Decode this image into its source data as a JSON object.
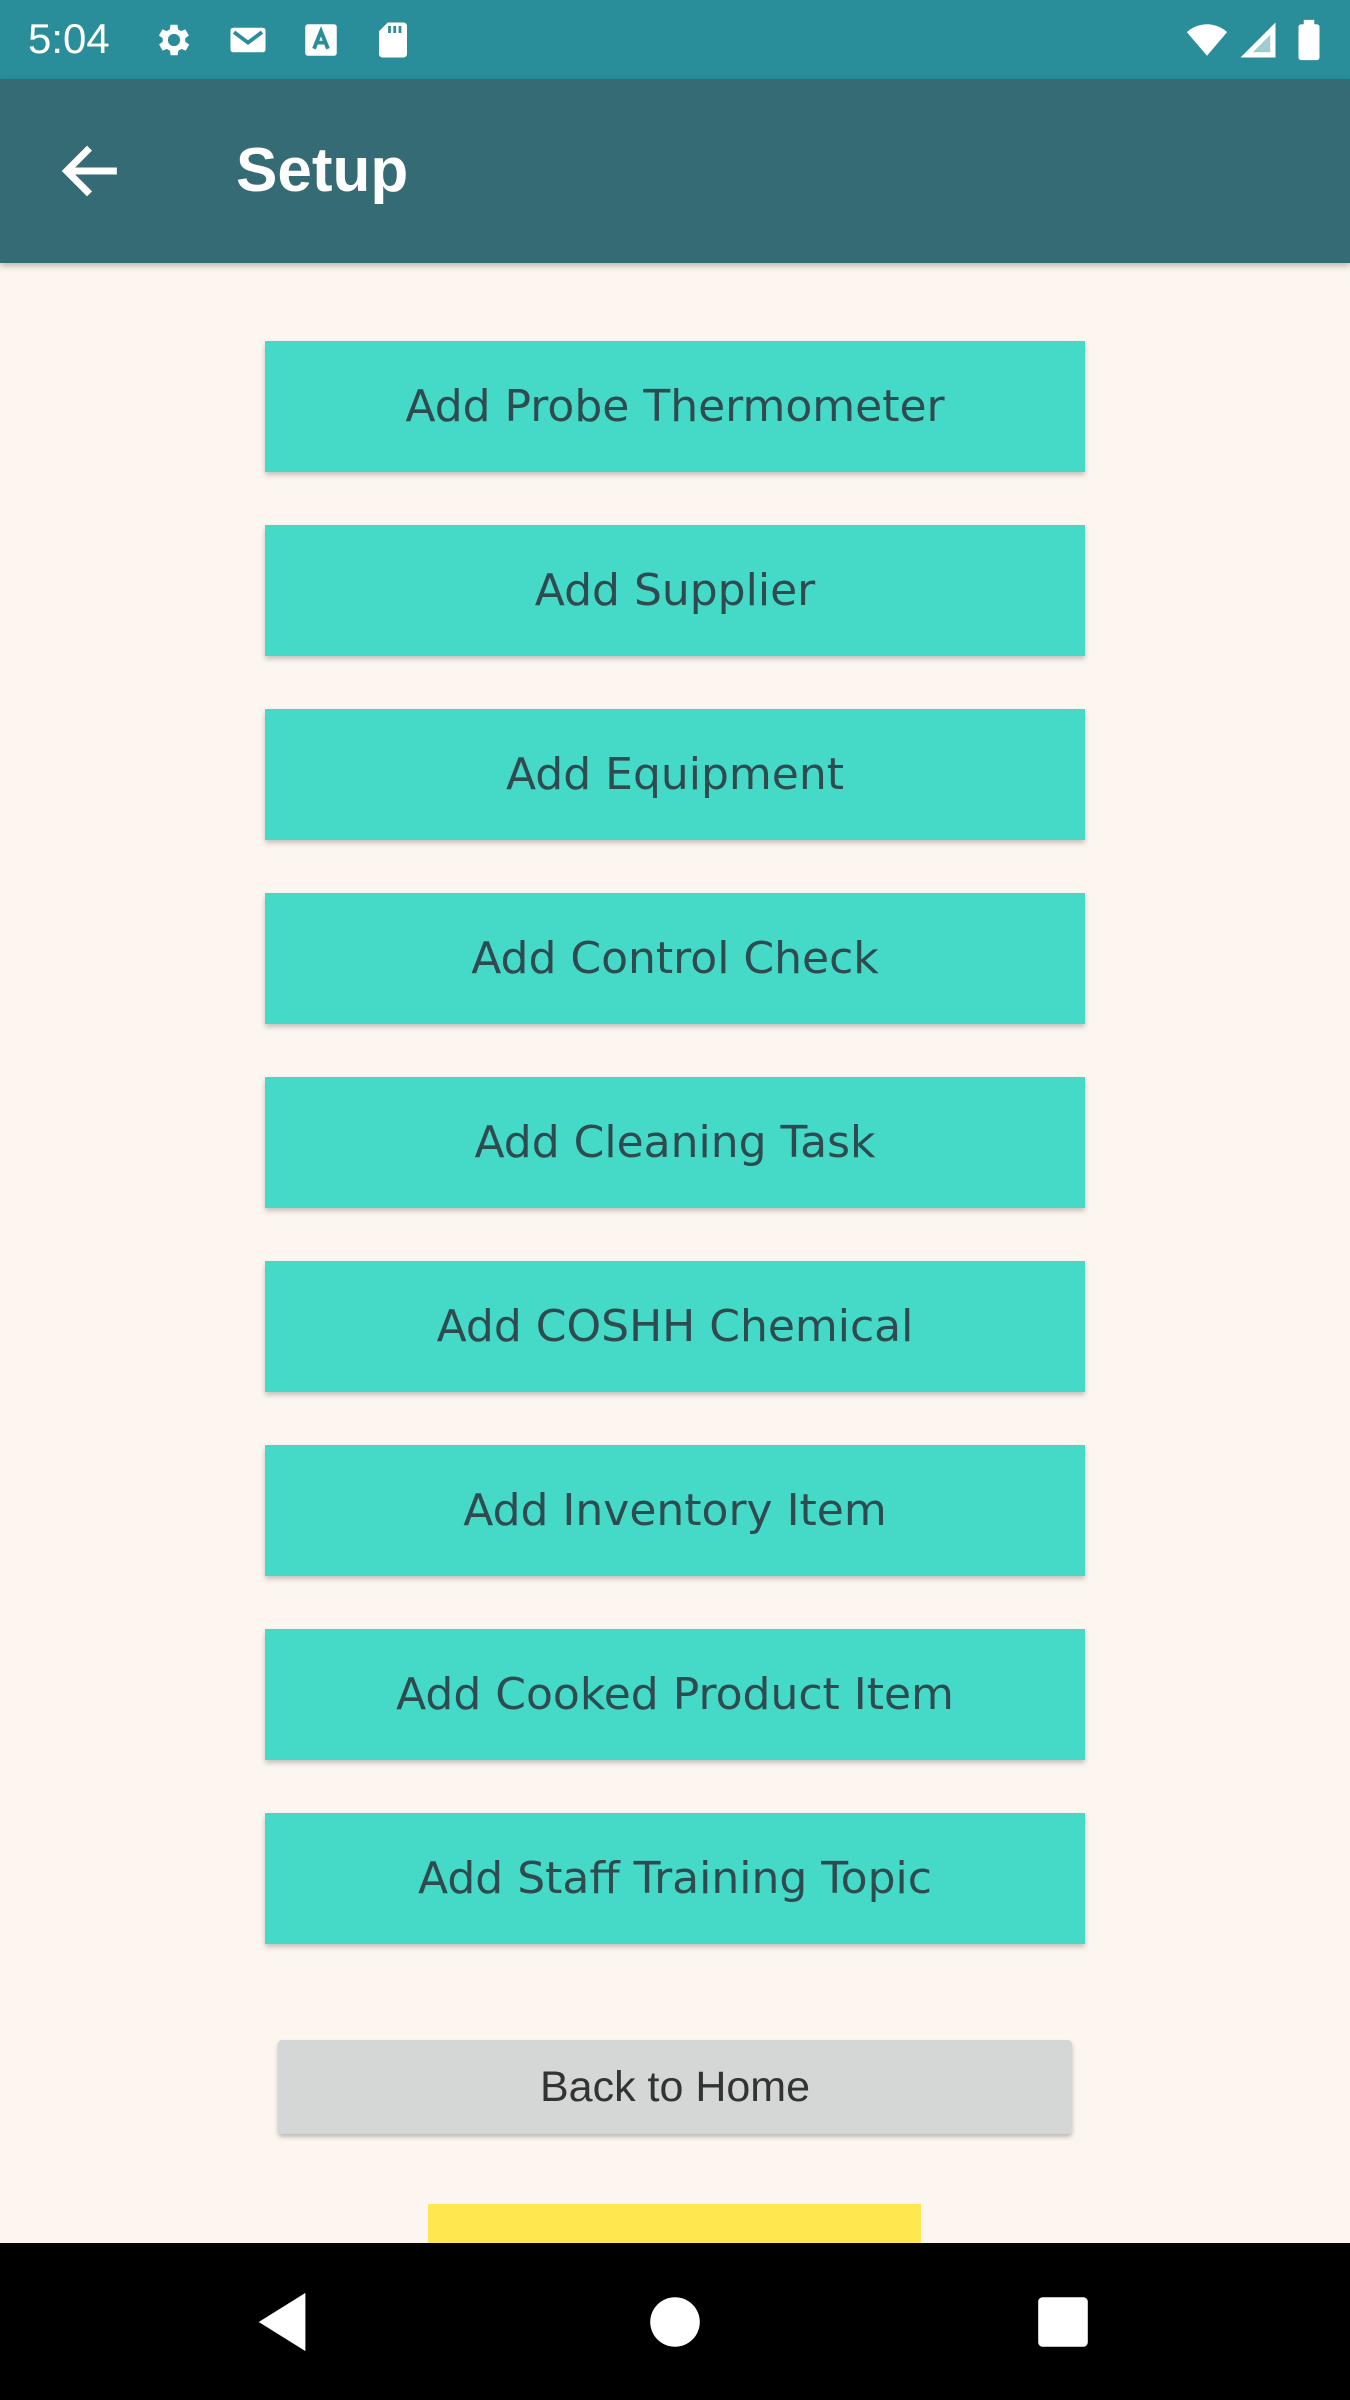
{
  "status_bar": {
    "time": "5:04",
    "icons_left": [
      "gear-icon",
      "gmail-icon",
      "font-a-icon",
      "sd-card-icon"
    ],
    "icons_right": [
      "wifi-icon",
      "signal-icon",
      "battery-icon"
    ]
  },
  "app_bar": {
    "back_icon": "arrow-left-icon",
    "title": "Setup"
  },
  "actions": [
    {
      "label": "Add Probe Thermometer"
    },
    {
      "label": "Add Supplier"
    },
    {
      "label": "Add Equipment"
    },
    {
      "label": "Add Control Check"
    },
    {
      "label": "Add Cleaning Task"
    },
    {
      "label": "Add COSHH Chemical"
    },
    {
      "label": "Add Inventory Item"
    },
    {
      "label": "Add Cooked Product Item"
    },
    {
      "label": "Add Staff Training Topic"
    }
  ],
  "home_button": {
    "label": "Back to Home"
  },
  "colors": {
    "status_bar": "#2A8D9A",
    "app_bar": "#346B74",
    "background": "#FDF6F0",
    "action_button": "#45D9C8",
    "action_text": "#2F4B50",
    "home_button": "#D5D7D6",
    "yellow_accent": "#FFE750"
  },
  "nav_bar": {
    "icons": [
      "back-triangle-icon",
      "home-circle-icon",
      "recents-square-icon"
    ]
  }
}
